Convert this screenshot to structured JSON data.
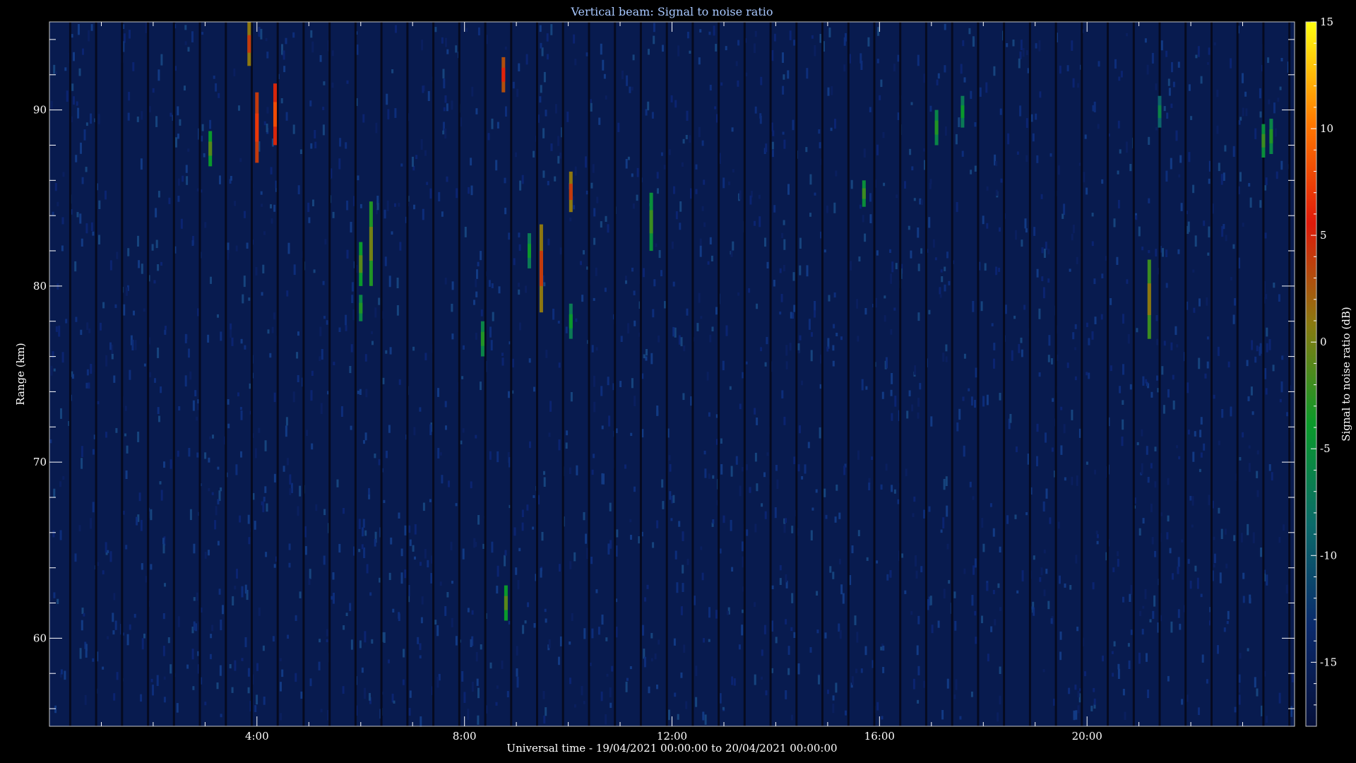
{
  "chart_data": {
    "type": "heatmap",
    "title": "Vertical beam: Signal to noise ratio",
    "xlabel": "Universal time - 19/04/2021 00:00:00 to 20/04/2021 00:00:00",
    "ylabel": "Range (km)",
    "x_unit": "hours UT",
    "xlim": [
      0,
      24
    ],
    "ylim": [
      55,
      95
    ],
    "x_ticks": [
      "4:00",
      "8:00",
      "12:00",
      "16:00",
      "20:00"
    ],
    "x_tick_values": [
      4,
      8,
      12,
      16,
      20
    ],
    "y_ticks": [
      "60",
      "70",
      "80",
      "90"
    ],
    "y_tick_values": [
      60,
      70,
      80,
      90
    ],
    "background_snr_db": -16,
    "colorbar": {
      "label": "Signal to noise ratio (dB)",
      "range": [
        -18,
        15
      ],
      "ticks": [
        "15",
        "10",
        "5",
        "0",
        "-5",
        "-10",
        "-15"
      ],
      "tick_values": [
        15,
        10,
        5,
        0,
        -5,
        -10,
        -15
      ],
      "colors": [
        "#06103a",
        "#0a2a6c",
        "#0b6a6a",
        "#0a9a2a",
        "#8a7a10",
        "#e01a0a",
        "#ff7a00",
        "#ffff10"
      ]
    },
    "echoes": [
      {
        "t": 3.85,
        "r0": 92.5,
        "r1": 95.0,
        "snr": 1
      },
      {
        "t": 4.0,
        "r0": 87.0,
        "r1": 91.0,
        "snr": 4
      },
      {
        "t": 4.35,
        "r0": 88.0,
        "r1": 91.5,
        "snr": 5
      },
      {
        "t": 3.1,
        "r0": 86.8,
        "r1": 88.8,
        "snr": -4
      },
      {
        "t": 6.0,
        "r0": 80.0,
        "r1": 82.5,
        "snr": -4
      },
      {
        "t": 6.0,
        "r0": 78.0,
        "r1": 79.5,
        "snr": -6
      },
      {
        "t": 6.2,
        "r0": 80.0,
        "r1": 84.8,
        "snr": -3
      },
      {
        "t": 8.75,
        "r0": 91.0,
        "r1": 93.0,
        "snr": 3
      },
      {
        "t": 8.35,
        "r0": 76.0,
        "r1": 78.0,
        "snr": -6
      },
      {
        "t": 8.8,
        "r0": 61.0,
        "r1": 63.0,
        "snr": -4
      },
      {
        "t": 9.25,
        "r0": 81.0,
        "r1": 83.0,
        "snr": -7
      },
      {
        "t": 9.48,
        "r0": 78.5,
        "r1": 83.5,
        "snr": 1
      },
      {
        "t": 10.05,
        "r0": 84.2,
        "r1": 86.5,
        "snr": 1
      },
      {
        "t": 10.05,
        "r0": 77.0,
        "r1": 79.0,
        "snr": -7
      },
      {
        "t": 11.6,
        "r0": 82.0,
        "r1": 85.3,
        "snr": -5
      },
      {
        "t": 15.7,
        "r0": 84.5,
        "r1": 86.0,
        "snr": -5
      },
      {
        "t": 17.1,
        "r0": 88.0,
        "r1": 90.0,
        "snr": -6
      },
      {
        "t": 17.6,
        "r0": 89.0,
        "r1": 90.8,
        "snr": -7
      },
      {
        "t": 21.2,
        "r0": 77.0,
        "r1": 81.5,
        "snr": -2
      },
      {
        "t": 21.4,
        "r0": 89.0,
        "r1": 90.8,
        "snr": -9
      },
      {
        "t": 23.4,
        "r0": 87.3,
        "r1": 89.2,
        "snr": -5
      },
      {
        "t": 23.55,
        "r0": 87.5,
        "r1": 89.5,
        "snr": -6
      }
    ]
  }
}
